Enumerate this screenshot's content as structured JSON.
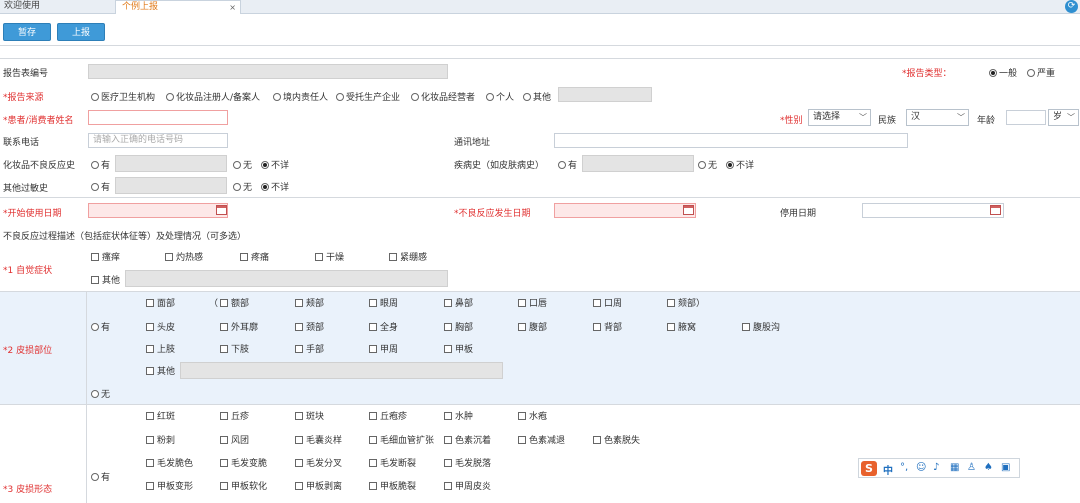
{
  "tabs": [
    {
      "label": "欢迎使用"
    },
    {
      "label": "个例上报"
    }
  ],
  "tab_close": "×",
  "toolbar": {
    "save": "暂存",
    "submit": "上报"
  },
  "form": {
    "report_no": "报告表编号",
    "report_type": "*报告类型：",
    "report_type_options": [
      "一般",
      "严重"
    ],
    "source_label": "*报告来源",
    "source_options": [
      "医疗卫生机构",
      "化妆品注册人/备案人",
      "境内责任人",
      "受托生产企业",
      "化妆品经营者",
      "个人",
      "其他"
    ],
    "patient_name": "*患者/消费者姓名",
    "gender_label": "*性别",
    "gender_value": "请选择",
    "ethnic_label": "民族",
    "ethnic_value": "汉",
    "age_label": "年龄",
    "age_unit": "岁",
    "phone_label": "联系电话",
    "phone_placeholder": "请输入正确的电话号码",
    "address_label": "通讯地址",
    "cosmetic_history": "化妆品不良反应史",
    "disease_history": "疾病史（如皮肤病史）",
    "allergy_history": "其他过敏史",
    "yes": "有",
    "no": "无",
    "unknown": "不详",
    "start_date": "*开始使用日期",
    "adverse_date": "*不良反应发生日期",
    "stop_date": "停用日期",
    "process_desc": "不良反应过程描述（包括症状体征等）及处理情况（可多选）",
    "sec1_label": "*1 自觉症状",
    "sec1_options": [
      "瘙痒",
      "灼热感",
      "疼痛",
      "干燥",
      "紧绷感"
    ],
    "other": "其他",
    "sec2_label": "*2 皮损部位",
    "paren_open": "（",
    "paren_close": "）",
    "sec2_rows": [
      [
        "面部",
        "额部",
        "颊部",
        "眼周",
        "鼻部",
        "口唇",
        "口周",
        "颏部）"
      ],
      [
        "头皮",
        "外耳廓",
        "颈部",
        "全身",
        "胸部",
        "腹部",
        "背部",
        "腋窝",
        "腹股沟"
      ],
      [
        "上肢",
        "下肢",
        "手部",
        "甲周",
        "甲板"
      ]
    ],
    "sec3_label": "*3 皮损形态",
    "sec3_rows": [
      [
        "红斑",
        "丘疹",
        "斑块",
        "丘疱疹",
        "水肿",
        "水疱"
      ],
      [
        "粉刺",
        "风团",
        "毛囊炎样",
        "毛细血管扩张",
        "色素沉着",
        "色素减退",
        "色素脱失"
      ],
      [
        "毛发脆色",
        "毛发变脆",
        "毛发分叉",
        "毛发断裂",
        "毛发脱落"
      ],
      [
        "甲板变形",
        "甲板软化",
        "甲板剥离",
        "甲板脆裂",
        "甲周皮炎"
      ]
    ]
  },
  "ime": {
    "logo": "S",
    "mode": "中",
    "punct": "°,"
  }
}
